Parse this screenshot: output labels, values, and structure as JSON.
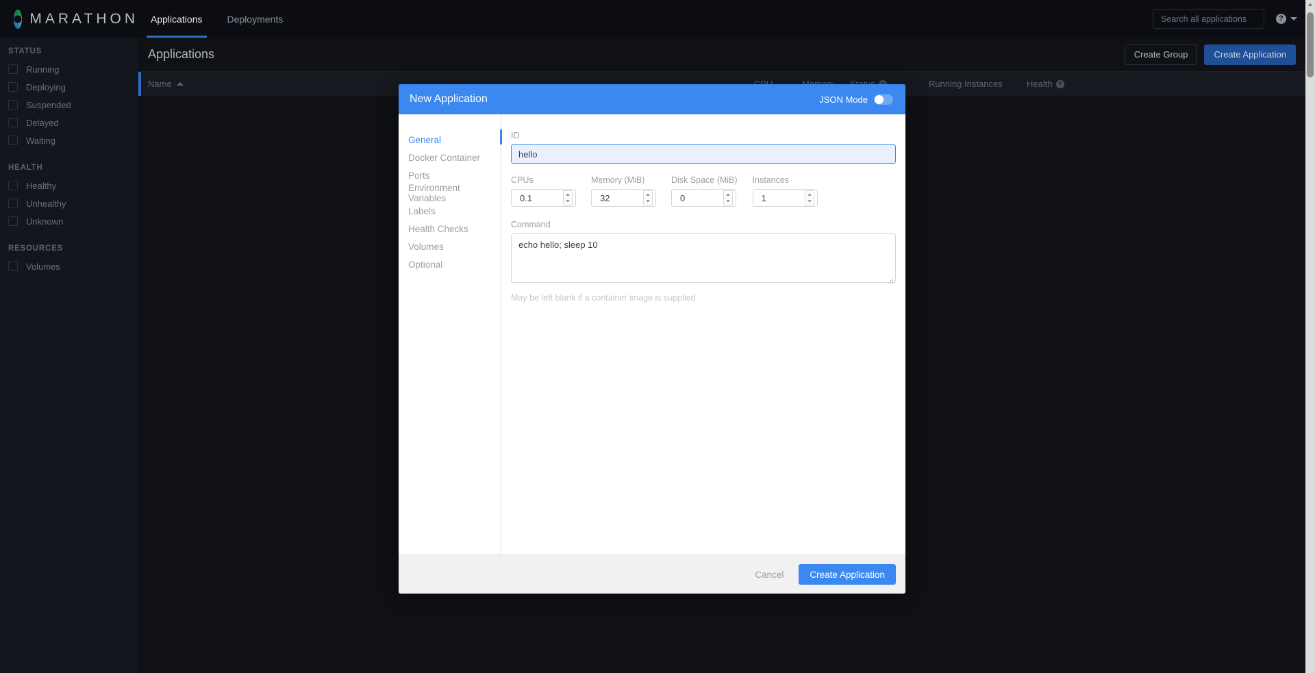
{
  "navbar": {
    "brand": "MARATHON",
    "links": [
      {
        "label": "Applications",
        "active": true
      },
      {
        "label": "Deployments",
        "active": false
      }
    ],
    "search_placeholder": "Search all applications",
    "search_value": "",
    "help_glyph": "?"
  },
  "sidebar": {
    "groups": [
      {
        "title": "STATUS",
        "items": [
          {
            "label": "Running",
            "checked": false
          },
          {
            "label": "Deploying",
            "checked": false
          },
          {
            "label": "Suspended",
            "checked": false
          },
          {
            "label": "Delayed",
            "checked": false
          },
          {
            "label": "Waiting",
            "checked": false
          }
        ]
      },
      {
        "title": "HEALTH",
        "items": [
          {
            "label": "Healthy",
            "checked": false
          },
          {
            "label": "Unhealthy",
            "checked": false
          },
          {
            "label": "Unknown",
            "checked": false
          }
        ]
      },
      {
        "title": "RESOURCES",
        "items": [
          {
            "label": "Volumes",
            "checked": false
          }
        ]
      }
    ]
  },
  "page": {
    "title": "Applications",
    "create_group_label": "Create Group",
    "create_application_label": "Create Application",
    "table_headers": {
      "name": "Name",
      "cpu": "CPU",
      "memory": "Memory",
      "status": "Status",
      "running_instances": "Running Instances",
      "health": "Health",
      "help_glyph": "?"
    }
  },
  "modal": {
    "title": "New Application",
    "json_mode_label": "JSON Mode",
    "json_mode_on": false,
    "nav_items": [
      {
        "label": "General",
        "active": true
      },
      {
        "label": "Docker Container",
        "active": false
      },
      {
        "label": "Ports",
        "active": false
      },
      {
        "label": "Environment Variables",
        "active": false
      },
      {
        "label": "Labels",
        "active": false
      },
      {
        "label": "Health Checks",
        "active": false
      },
      {
        "label": "Volumes",
        "active": false
      },
      {
        "label": "Optional",
        "active": false
      }
    ],
    "fields": {
      "id_label": "ID",
      "id_value": "hello",
      "id_placeholder": "",
      "cpus_label": "CPUs",
      "cpus_value": "0.1",
      "memory_label": "Memory (MiB)",
      "memory_value": "32",
      "disk_label": "Disk Space (MiB)",
      "disk_value": "0",
      "instances_label": "Instances",
      "instances_value": "1",
      "command_label": "Command",
      "command_value": "echo hello; sleep 10",
      "command_hint": "May be left blank if a container image is supplied"
    },
    "footer": {
      "cancel_label": "Cancel",
      "create_label": "Create Application"
    }
  },
  "colors": {
    "accent_blue": "#3b89f0",
    "nav_active_blue": "#2e6fc4",
    "primary_button": "#1f4f96",
    "dark_bg": "#0f1115",
    "sidebar_bg": "#13161c"
  }
}
